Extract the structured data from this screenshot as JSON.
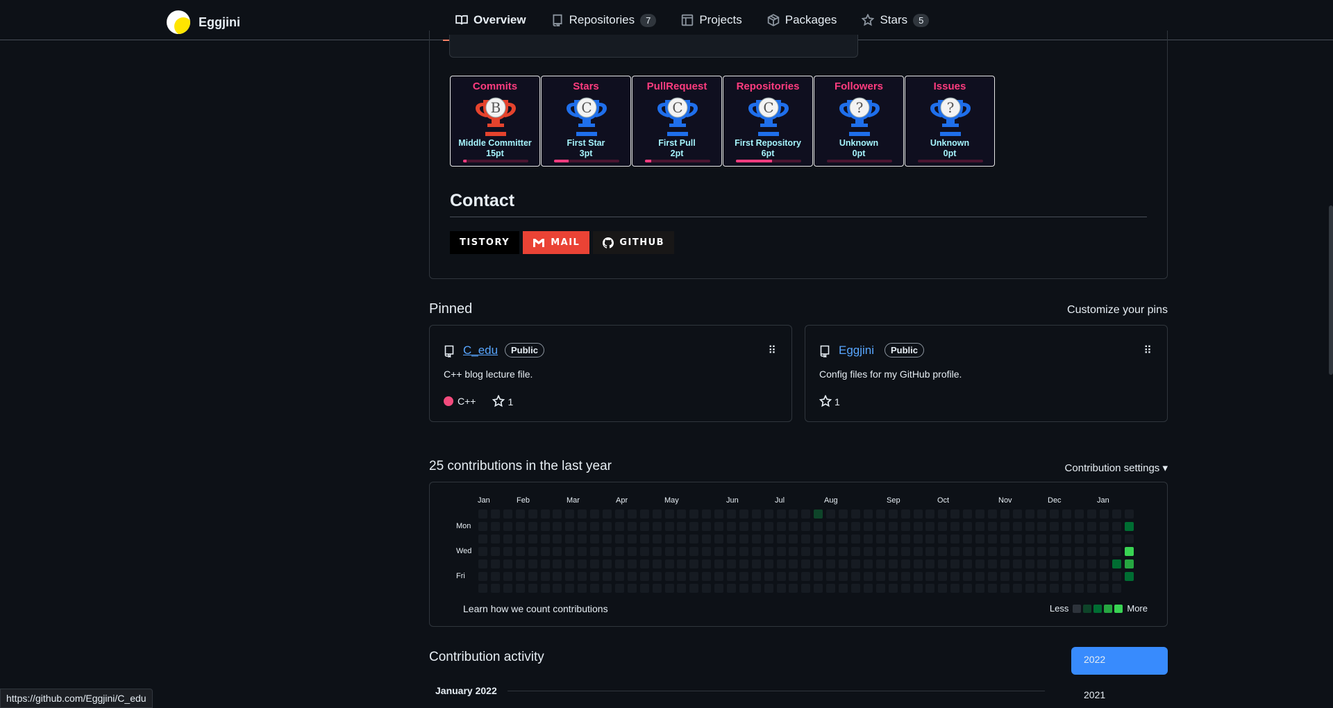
{
  "header": {
    "username": "Eggjini",
    "tabs": [
      {
        "label": "Overview",
        "icon": "book-icon",
        "active": true
      },
      {
        "label": "Repositories",
        "icon": "repo-icon",
        "count": "7"
      },
      {
        "label": "Projects",
        "icon": "project-icon"
      },
      {
        "label": "Packages",
        "icon": "package-icon"
      },
      {
        "label": "Stars",
        "icon": "star-icon",
        "count": "5"
      }
    ]
  },
  "trophies": [
    {
      "title": "Commits",
      "rank": "B",
      "name": "Middle Committer",
      "points": "15pt",
      "progress": 0.05,
      "color": "#e5432d"
    },
    {
      "title": "Stars",
      "rank": "C",
      "name": "First Star",
      "points": "3pt",
      "progress": 0.22,
      "color": "#1f6feb"
    },
    {
      "title": "PullRequest",
      "rank": "C",
      "name": "First Pull",
      "points": "2pt",
      "progress": 0.1,
      "color": "#1f6feb"
    },
    {
      "title": "Repositories",
      "rank": "C",
      "name": "First Repository",
      "points": "6pt",
      "progress": 0.55,
      "color": "#1f6feb"
    },
    {
      "title": "Followers",
      "rank": "?",
      "name": "Unknown",
      "points": "0pt",
      "progress": 0.0,
      "color": "#1f6feb"
    },
    {
      "title": "Issues",
      "rank": "?",
      "name": "Unknown",
      "points": "0pt",
      "progress": 0.0,
      "color": "#1f6feb"
    }
  ],
  "contact": {
    "heading": "Contact",
    "badges": [
      {
        "label": "TISTORY",
        "icon": "none"
      },
      {
        "label": "MAIL",
        "icon": "gmail-icon"
      },
      {
        "label": "GITHUB",
        "icon": "github-icon"
      }
    ]
  },
  "pinned": {
    "heading": "Pinned",
    "customize": "Customize your pins",
    "cards": [
      {
        "name": "C_edu",
        "visibility": "Public",
        "description": "C++ blog lecture file.",
        "language": "C++",
        "language_color": "#f34b7d",
        "stars": "1"
      },
      {
        "name": "Eggjini",
        "visibility": "Public",
        "description": "Config files for my GitHub profile.",
        "stars": "1"
      }
    ]
  },
  "contributions": {
    "heading": "25 contributions in the last year",
    "settings": "Contribution settings ▾",
    "months": [
      "Jan",
      "Feb",
      "Mar",
      "Apr",
      "May",
      "Jun",
      "Jul",
      "Aug",
      "Sep",
      "Oct",
      "Nov",
      "Dec",
      "Jan"
    ],
    "days": [
      "Mon",
      "Wed",
      "Fri"
    ],
    "learn": "Learn how we count contributions",
    "less": "Less",
    "more": "More",
    "active_cells": [
      {
        "week": 27,
        "day": 0,
        "level": 1
      },
      {
        "week": 52,
        "day": 1,
        "level": 2
      },
      {
        "week": 52,
        "day": 3,
        "level": 4
      },
      {
        "week": 51,
        "day": 4,
        "level": 2
      },
      {
        "week": 52,
        "day": 4,
        "level": 3
      },
      {
        "week": 52,
        "day": 5,
        "level": 2
      }
    ],
    "level_colors": [
      "#161b22",
      "#0e4429",
      "#006d32",
      "#26a641",
      "#39d353"
    ]
  },
  "activity": {
    "heading": "Contribution activity",
    "years": [
      "2022",
      "2021"
    ],
    "month": "January 2022"
  },
  "status_url": "https://github.com/Eggjini/C_edu"
}
